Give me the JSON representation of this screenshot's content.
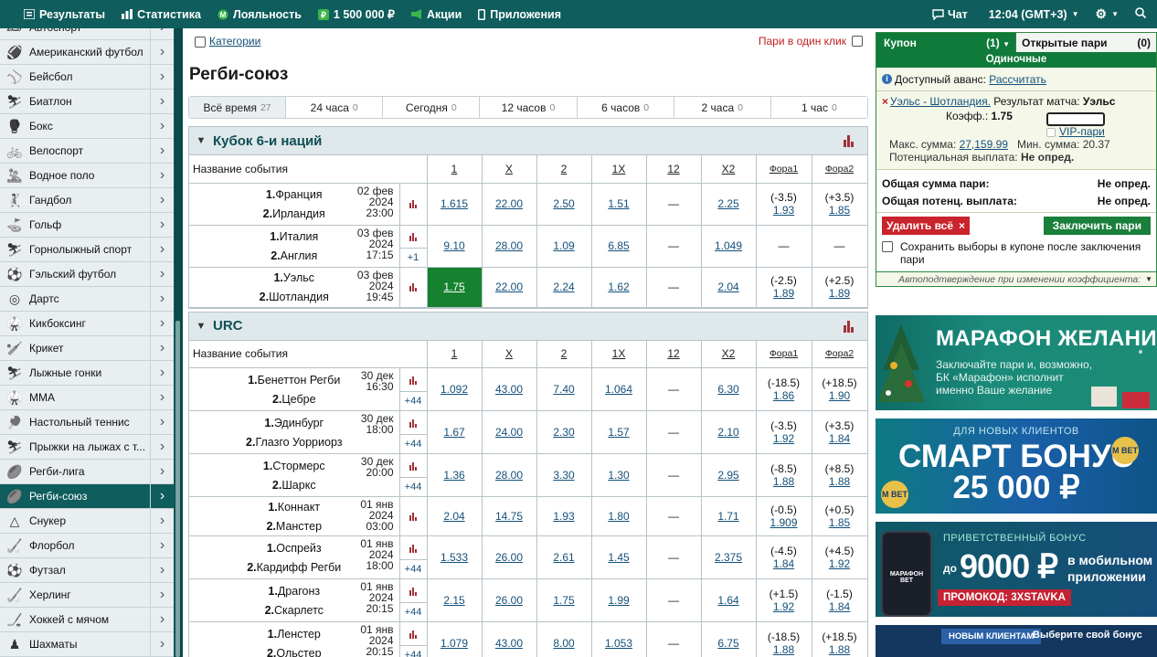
{
  "topbar": {
    "results": "Результаты",
    "stats": "Статистика",
    "loyalty": "Лояльность",
    "bonus": "1 500 000 ₽",
    "promo": "Акции",
    "apps": "Приложения",
    "chat": "Чат",
    "time": "12:04 (GMT+3)"
  },
  "sidebar": {
    "items": [
      {
        "label": "Автоспорт",
        "icon": "car-icon"
      },
      {
        "label": "Американский футбол",
        "icon": "football-icon"
      },
      {
        "label": "Бейсбол",
        "icon": "baseball-icon"
      },
      {
        "label": "Биатлон",
        "icon": "biathlon-icon"
      },
      {
        "label": "Бокс",
        "icon": "boxing-icon"
      },
      {
        "label": "Велоспорт",
        "icon": "bicycle-icon"
      },
      {
        "label": "Водное поло",
        "icon": "waterpolo-icon"
      },
      {
        "label": "Гандбол",
        "icon": "handball-icon"
      },
      {
        "label": "Гольф",
        "icon": "golf-icon"
      },
      {
        "label": "Горнолыжный спорт",
        "icon": "ski-icon"
      },
      {
        "label": "Гэльский футбол",
        "icon": "gaelic-icon"
      },
      {
        "label": "Дартс",
        "icon": "darts-icon"
      },
      {
        "label": "Кикбоксинг",
        "icon": "kickboxing-icon"
      },
      {
        "label": "Крикет",
        "icon": "cricket-icon"
      },
      {
        "label": "Лыжные гонки",
        "icon": "crosscountry-icon"
      },
      {
        "label": "MMA",
        "icon": "mma-icon"
      },
      {
        "label": "Настольный теннис",
        "icon": "tabletennis-icon"
      },
      {
        "label": "Прыжки на лыжах с т...",
        "icon": "skijump-icon"
      },
      {
        "label": "Регби-лига",
        "icon": "rugby-icon"
      },
      {
        "label": "Регби-союз",
        "icon": "rugby-icon"
      },
      {
        "label": "Снукер",
        "icon": "snooker-icon"
      },
      {
        "label": "Флорбол",
        "icon": "floorball-icon"
      },
      {
        "label": "Футзал",
        "icon": "futsal-icon"
      },
      {
        "label": "Херлинг",
        "icon": "hurling-icon"
      },
      {
        "label": "Хоккей с мячом",
        "icon": "bandy-icon"
      },
      {
        "label": "Шахматы",
        "icon": "chess-icon"
      }
    ]
  },
  "main": {
    "categories": "Категории",
    "oneclick": "Пари в один клик",
    "title": "Регби-союз",
    "filters": [
      {
        "label": "Всё время",
        "count": "27"
      },
      {
        "label": "24 часа",
        "count": "0"
      },
      {
        "label": "Сегодня",
        "count": "0"
      },
      {
        "label": "12 часов",
        "count": "0"
      },
      {
        "label": "6 часов",
        "count": "0"
      },
      {
        "label": "2 часа",
        "count": "0"
      },
      {
        "label": "1 час",
        "count": "0"
      }
    ],
    "cols": {
      "name": "Название события",
      "c1": "1",
      "cx": "X",
      "c2": "2",
      "c1x": "1X",
      "c12": "12",
      "cx2": "X2",
      "f1": "Фора1",
      "f2": "Фора2"
    }
  },
  "leagues": [
    {
      "name": "Кубок 6-и наций",
      "events": [
        {
          "t1": "Франция",
          "t2": "Ирландия",
          "d1": "02 фев",
          "d2": "2024",
          "d3": "23:00",
          "plus": "",
          "o1": "1.615",
          "ox": "22.00",
          "o2": "2.50",
          "o1x": "1.51",
          "o12": "—",
          "ox2": "2.25",
          "f1h": "(-3.5)",
          "f1o": "1.93",
          "f2h": "(+3.5)",
          "f2o": "1.85"
        },
        {
          "t1": "Италия",
          "t2": "Англия",
          "d1": "03 фев",
          "d2": "2024",
          "d3": "17:15",
          "plus": "+1",
          "o1": "9.10",
          "ox": "28.00",
          "o2": "1.09",
          "o1x": "6.85",
          "o12": "—",
          "ox2": "1.049",
          "f1h": "—",
          "f1o": "",
          "f2h": "—",
          "f2o": ""
        },
        {
          "t1": "Уэльс",
          "t2": "Шотландия",
          "d1": "03 фев",
          "d2": "2024",
          "d3": "19:45",
          "plus": "",
          "o1": "1.75",
          "ox": "22.00",
          "o2": "2.24",
          "o1x": "1.62",
          "o12": "—",
          "ox2": "2.04",
          "f1h": "(-2.5)",
          "f1o": "1.89",
          "f2h": "(+2.5)",
          "f2o": "1.89"
        }
      ]
    },
    {
      "name": "URC",
      "events": [
        {
          "t1": "Бенеттон Регби",
          "t2": "Цебре",
          "d1": "30 дек",
          "d2": "",
          "d3": "16:30",
          "plus": "+44",
          "o1": "1.092",
          "ox": "43.00",
          "o2": "7.40",
          "o1x": "1.064",
          "o12": "—",
          "ox2": "6.30",
          "f1h": "(-18.5)",
          "f1o": "1.86",
          "f2h": "(+18.5)",
          "f2o": "1.90"
        },
        {
          "t1": "Эдинбург",
          "t2": "Глазго Уорриорз",
          "d1": "30 дек",
          "d2": "",
          "d3": "18:00",
          "plus": "+44",
          "o1": "1.67",
          "ox": "24.00",
          "o2": "2.30",
          "o1x": "1.57",
          "o12": "—",
          "ox2": "2.10",
          "f1h": "(-3.5)",
          "f1o": "1.92",
          "f2h": "(+3.5)",
          "f2o": "1.84"
        },
        {
          "t1": "Стормерс",
          "t2": "Шаркс",
          "d1": "30 дек",
          "d2": "",
          "d3": "20:00",
          "plus": "+44",
          "o1": "1.36",
          "ox": "28.00",
          "o2": "3.30",
          "o1x": "1.30",
          "o12": "—",
          "ox2": "2.95",
          "f1h": "(-8.5)",
          "f1o": "1.88",
          "f2h": "(+8.5)",
          "f2o": "1.88"
        },
        {
          "t1": "Коннакт",
          "t2": "Манстер",
          "d1": "01 янв",
          "d2": "2024",
          "d3": "03:00",
          "plus": "",
          "o1": "2.04",
          "ox": "14.75",
          "o2": "1.93",
          "o1x": "1.80",
          "o12": "—",
          "ox2": "1.71",
          "f1h": "(-0.5)",
          "f1o": "1.909",
          "f2h": "(+0.5)",
          "f2o": "1.85"
        },
        {
          "t1": "Оспрейз",
          "t2": "Кардифф Регби",
          "d1": "01 янв",
          "d2": "2024",
          "d3": "18:00",
          "plus": "+44",
          "o1": "1.533",
          "ox": "26.00",
          "o2": "2.61",
          "o1x": "1.45",
          "o12": "—",
          "ox2": "2.375",
          "f1h": "(-4.5)",
          "f1o": "1.84",
          "f2h": "(+4.5)",
          "f2o": "1.92"
        },
        {
          "t1": "Драгонз",
          "t2": "Скарлетс",
          "d1": "01 янв",
          "d2": "2024",
          "d3": "20:15",
          "plus": "+44",
          "o1": "2.15",
          "ox": "26.00",
          "o2": "1.75",
          "o1x": "1.99",
          "o12": "—",
          "ox2": "1.64",
          "f1h": "(+1.5)",
          "f1o": "1.92",
          "f2h": "(-1.5)",
          "f2o": "1.84"
        },
        {
          "t1": "Ленстер",
          "t2": "Ольстер",
          "d1": "01 янв",
          "d2": "2024",
          "d3": "20:15",
          "plus": "+44",
          "o1": "1.079",
          "ox": "43.00",
          "o2": "8.00",
          "o1x": "1.053",
          "o12": "—",
          "ox2": "6.75",
          "f1h": "(-18.5)",
          "f1o": "1.88",
          "f2h": "(+18.5)",
          "f2o": "1.88"
        }
      ]
    }
  ],
  "coupon": {
    "tab1": "Купон",
    "tab1_count": "(1)",
    "tab2": "Открытые пари",
    "tab2_count": "(0)",
    "sub": "Одиночные",
    "avail": "Доступный аванс:",
    "avail_link": "Рассчитать",
    "bet_event": "Уэльс - Шотландия.",
    "bet_market": "Результат матча:",
    "bet_pick": "Уэльс",
    "coef_label": "Коэфф.:",
    "coef": "1.75",
    "vip": "VIP-пари",
    "max_label": "Макс. сумма:",
    "max": "27,159.99",
    "min_label": "Мин. сумма:",
    "min": "20.37",
    "potential_label": "Потенциальная выплата:",
    "potential": "Не опред.",
    "total_label": "Общая сумма пари:",
    "total": "Не опред.",
    "total_pot_label": "Общая потенц. выплата:",
    "total_pot": "Не опред.",
    "delete_all": "Удалить всё",
    "place": "Заключить пари",
    "save": "Сохранить выборы в купоне после заключения пари",
    "auto": "Автоподтверждение при изменении коэффициента:"
  },
  "banners": {
    "b1": {
      "title": "МАРАФОН ЖЕЛАНИЙ",
      "text1": "Заключайте пари и, возможно,",
      "text2": "БК «Марафон» исполнит",
      "text3": "именно Ваше желание"
    },
    "b2": {
      "top": "ДЛЯ НОВЫХ КЛИЕНТОВ",
      "title": "СМАРТ БОНУС",
      "amount": "25 000 ₽",
      "logo": "М BET"
    },
    "b3": {
      "top": "ПРИВЕТСТВЕННЫЙ БОНУС",
      "pre": "до",
      "amount": "9000 ₽",
      "side1": "в мобильном",
      "side2": "приложении",
      "promo": "ПРОМОКОД: 3XSTAVKA",
      "phone": "МАРАФОН BET"
    },
    "b4": {
      "tag": "НОВЫМ КЛИЕНТАМ",
      "text": "Выберите свой бонус"
    }
  },
  "colors": {
    "brand": "#0f5d5d",
    "green": "#16822f",
    "red": "#c9232b"
  }
}
